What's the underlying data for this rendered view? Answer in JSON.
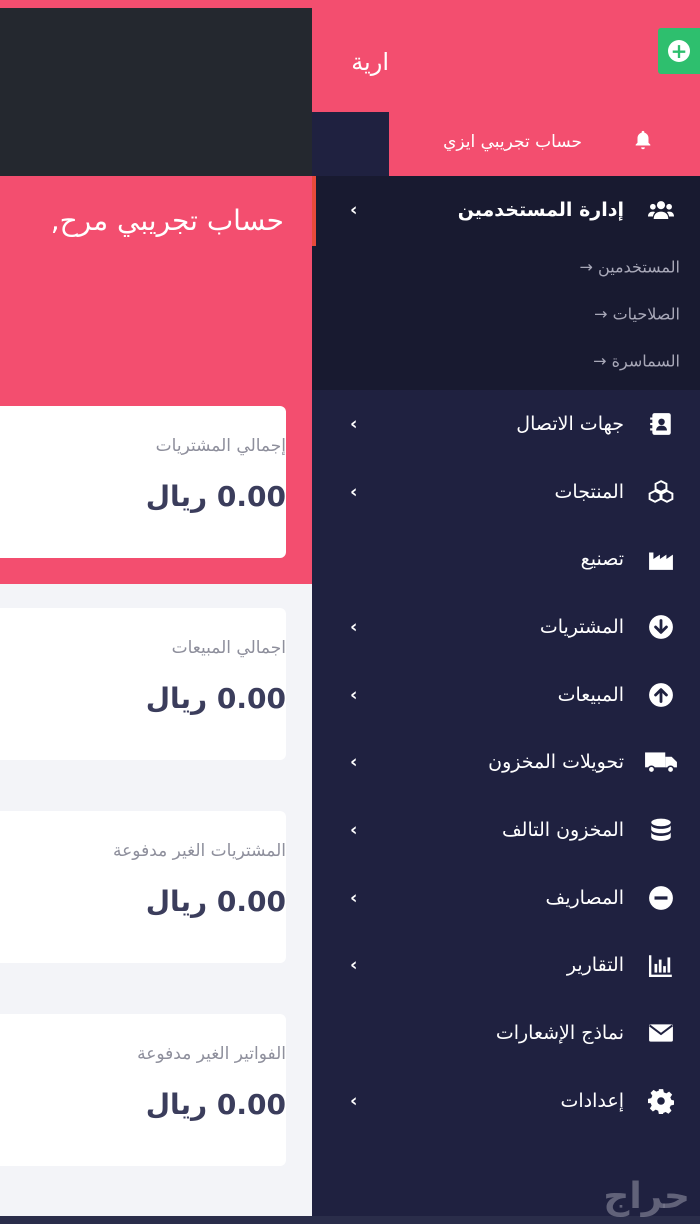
{
  "header": {
    "title_partial": "ارية",
    "account_name": "حساب تجريبي ايزي",
    "add_icon": "plus-circle-icon",
    "bell_icon": "bell-icon"
  },
  "sidebar": {
    "users_group": {
      "label": "إدارة المستخدمين",
      "icon": "users-icon",
      "children": [
        "→ المستخدمين",
        "→ الصلاحيات",
        "→ السماسرة"
      ]
    },
    "items": [
      {
        "label": "جهات الاتصال",
        "icon": "address-book-icon",
        "chevron": true
      },
      {
        "label": "المنتجات",
        "icon": "cubes-icon",
        "chevron": true
      },
      {
        "label": "تصنيع",
        "icon": "industry-icon",
        "chevron": false
      },
      {
        "label": "المشتريات",
        "icon": "arrow-circle-down-icon",
        "chevron": true
      },
      {
        "label": "المبيعات",
        "icon": "arrow-circle-up-icon",
        "chevron": true
      },
      {
        "label": "تحويلات المخزون",
        "icon": "truck-icon",
        "chevron": true
      },
      {
        "label": "المخزون التالف",
        "icon": "database-icon",
        "chevron": true
      },
      {
        "label": "المصاريف",
        "icon": "minus-circle-icon",
        "chevron": true
      },
      {
        "label": "التقارير",
        "icon": "bar-chart-icon",
        "chevron": true
      },
      {
        "label": "نماذج الإشعارات",
        "icon": "envelope-icon",
        "chevron": false
      },
      {
        "label": "إعدادات",
        "icon": "cog-icon",
        "chevron": true
      }
    ]
  },
  "main": {
    "welcome": ",حساب تجريبي مرح",
    "cards": [
      {
        "title": "إجمالي المشتريات",
        "value": "0.00 ريال"
      },
      {
        "title": "اجمالي المبيعات",
        "value": "0.00 ريال"
      },
      {
        "title": "المشتريات الغير مدفوعة",
        "value": "0.00 ريال"
      },
      {
        "title": "الفواتير الغير مدفوعة",
        "value": "0.00 ريال"
      }
    ]
  },
  "watermark": "حراج",
  "colors": {
    "accent": "#f34e6f",
    "sidebar": "#1f2140",
    "add": "#2ebf6e"
  }
}
